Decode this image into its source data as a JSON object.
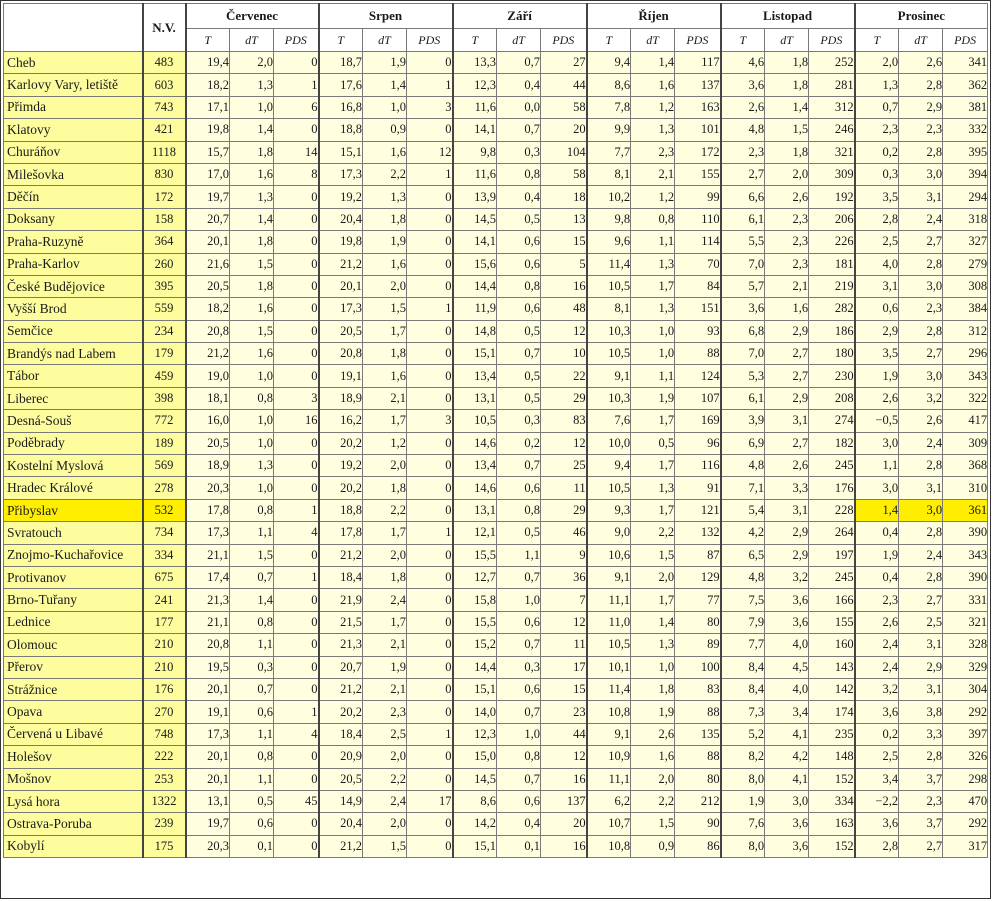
{
  "header": {
    "nv": "N.V.",
    "months": [
      "Červenec",
      "Srpen",
      "Září",
      "Říjen",
      "Listopad",
      "Prosinec"
    ],
    "sub": [
      "T",
      "dT",
      "PDS"
    ]
  },
  "rows": [
    {
      "name": "Cheb",
      "nv": "483",
      "v": [
        "19,4",
        "2,0",
        "0",
        "18,7",
        "1,9",
        "0",
        "13,3",
        "0,7",
        "27",
        "9,4",
        "1,4",
        "117",
        "4,6",
        "1,8",
        "252",
        "2,0",
        "2,6",
        "341"
      ]
    },
    {
      "name": "Karlovy Vary, letiště",
      "nv": "603",
      "v": [
        "18,2",
        "1,3",
        "1",
        "17,6",
        "1,4",
        "1",
        "12,3",
        "0,4",
        "44",
        "8,6",
        "1,6",
        "137",
        "3,6",
        "1,8",
        "281",
        "1,3",
        "2,8",
        "362"
      ]
    },
    {
      "name": "Přimda",
      "nv": "743",
      "v": [
        "17,1",
        "1,0",
        "6",
        "16,8",
        "1,0",
        "3",
        "11,6",
        "0,0",
        "58",
        "7,8",
        "1,2",
        "163",
        "2,6",
        "1,4",
        "312",
        "0,7",
        "2,9",
        "381"
      ]
    },
    {
      "name": "Klatovy",
      "nv": "421",
      "v": [
        "19,8",
        "1,4",
        "0",
        "18,8",
        "0,9",
        "0",
        "14,1",
        "0,7",
        "20",
        "9,9",
        "1,3",
        "101",
        "4,8",
        "1,5",
        "246",
        "2,3",
        "2,3",
        "332"
      ]
    },
    {
      "name": "Churáňov",
      "nv": "1118",
      "v": [
        "15,7",
        "1,8",
        "14",
        "15,1",
        "1,6",
        "12",
        "9,8",
        "0,3",
        "104",
        "7,7",
        "2,3",
        "172",
        "2,3",
        "1,8",
        "321",
        "0,2",
        "2,8",
        "395"
      ]
    },
    {
      "name": "Milešovka",
      "nv": "830",
      "v": [
        "17,0",
        "1,6",
        "8",
        "17,3",
        "2,2",
        "1",
        "11,6",
        "0,8",
        "58",
        "8,1",
        "2,1",
        "155",
        "2,7",
        "2,0",
        "309",
        "0,3",
        "3,0",
        "394"
      ]
    },
    {
      "name": "Děčín",
      "nv": "172",
      "v": [
        "19,7",
        "1,3",
        "0",
        "19,2",
        "1,3",
        "0",
        "13,9",
        "0,4",
        "18",
        "10,2",
        "1,2",
        "99",
        "6,6",
        "2,6",
        "192",
        "3,5",
        "3,1",
        "294"
      ]
    },
    {
      "name": "Doksany",
      "nv": "158",
      "v": [
        "20,7",
        "1,4",
        "0",
        "20,4",
        "1,8",
        "0",
        "14,5",
        "0,5",
        "13",
        "9,8",
        "0,8",
        "110",
        "6,1",
        "2,3",
        "206",
        "2,8",
        "2,4",
        "318"
      ]
    },
    {
      "name": "Praha-Ruzyně",
      "nv": "364",
      "v": [
        "20,1",
        "1,8",
        "0",
        "19,8",
        "1,9",
        "0",
        "14,1",
        "0,6",
        "15",
        "9,6",
        "1,1",
        "114",
        "5,5",
        "2,3",
        "226",
        "2,5",
        "2,7",
        "327"
      ]
    },
    {
      "name": "Praha-Karlov",
      "nv": "260",
      "v": [
        "21,6",
        "1,5",
        "0",
        "21,2",
        "1,6",
        "0",
        "15,6",
        "0,6",
        "5",
        "11,4",
        "1,3",
        "70",
        "7,0",
        "2,3",
        "181",
        "4,0",
        "2,8",
        "279"
      ]
    },
    {
      "name": "České Budějovice",
      "nv": "395",
      "v": [
        "20,5",
        "1,8",
        "0",
        "20,1",
        "2,0",
        "0",
        "14,4",
        "0,8",
        "16",
        "10,5",
        "1,7",
        "84",
        "5,7",
        "2,1",
        "219",
        "3,1",
        "3,0",
        "308"
      ]
    },
    {
      "name": "Vyšší Brod",
      "nv": "559",
      "v": [
        "18,2",
        "1,6",
        "0",
        "17,3",
        "1,5",
        "1",
        "11,9",
        "0,6",
        "48",
        "8,1",
        "1,3",
        "151",
        "3,6",
        "1,6",
        "282",
        "0,6",
        "2,3",
        "384"
      ]
    },
    {
      "name": "Semčice",
      "nv": "234",
      "v": [
        "20,8",
        "1,5",
        "0",
        "20,5",
        "1,7",
        "0",
        "14,8",
        "0,5",
        "12",
        "10,3",
        "1,0",
        "93",
        "6,8",
        "2,9",
        "186",
        "2,9",
        "2,8",
        "312"
      ]
    },
    {
      "name": "Brandýs nad Labem",
      "nv": "179",
      "v": [
        "21,2",
        "1,6",
        "0",
        "20,8",
        "1,8",
        "0",
        "15,1",
        "0,7",
        "10",
        "10,5",
        "1,0",
        "88",
        "7,0",
        "2,7",
        "180",
        "3,5",
        "2,7",
        "296"
      ]
    },
    {
      "name": "Tábor",
      "nv": "459",
      "v": [
        "19,0",
        "1,0",
        "0",
        "19,1",
        "1,6",
        "0",
        "13,4",
        "0,5",
        "22",
        "9,1",
        "1,1",
        "124",
        "5,3",
        "2,7",
        "230",
        "1,9",
        "3,0",
        "343"
      ]
    },
    {
      "name": "Liberec",
      "nv": "398",
      "v": [
        "18,1",
        "0,8",
        "3",
        "18,9",
        "2,1",
        "0",
        "13,1",
        "0,5",
        "29",
        "10,3",
        "1,9",
        "107",
        "6,1",
        "2,9",
        "208",
        "2,6",
        "3,2",
        "322"
      ]
    },
    {
      "name": "Desná-Souš",
      "nv": "772",
      "v": [
        "16,0",
        "1,0",
        "16",
        "16,2",
        "1,7",
        "3",
        "10,5",
        "0,3",
        "83",
        "7,6",
        "1,7",
        "169",
        "3,9",
        "3,1",
        "274",
        "−0,5",
        "2,6",
        "417"
      ]
    },
    {
      "name": "Poděbrady",
      "nv": "189",
      "v": [
        "20,5",
        "1,0",
        "0",
        "20,2",
        "1,2",
        "0",
        "14,6",
        "0,2",
        "12",
        "10,0",
        "0,5",
        "96",
        "6,9",
        "2,7",
        "182",
        "3,0",
        "2,4",
        "309"
      ]
    },
    {
      "name": "Kostelní Myslová",
      "nv": "569",
      "v": [
        "18,9",
        "1,3",
        "0",
        "19,2",
        "2,0",
        "0",
        "13,4",
        "0,7",
        "25",
        "9,4",
        "1,7",
        "116",
        "4,8",
        "2,6",
        "245",
        "1,1",
        "2,8",
        "368"
      ]
    },
    {
      "name": "Hradec Králové",
      "nv": "278",
      "v": [
        "20,3",
        "1,0",
        "0",
        "20,2",
        "1,8",
        "0",
        "14,6",
        "0,6",
        "11",
        "10,5",
        "1,3",
        "91",
        "7,1",
        "3,3",
        "176",
        "3,0",
        "3,1",
        "310"
      ]
    },
    {
      "name": "Přibyslav",
      "nv": "532",
      "v": [
        "17,8",
        "0,8",
        "1",
        "18,8",
        "2,2",
        "0",
        "13,1",
        "0,8",
        "29",
        "9,3",
        "1,7",
        "121",
        "5,4",
        "3,1",
        "228",
        "1,4",
        "3,0",
        "361"
      ],
      "highlight": true
    },
    {
      "name": "Svratouch",
      "nv": "734",
      "v": [
        "17,3",
        "1,1",
        "4",
        "17,8",
        "1,7",
        "1",
        "12,1",
        "0,5",
        "46",
        "9,0",
        "2,2",
        "132",
        "4,2",
        "2,9",
        "264",
        "0,4",
        "2,8",
        "390"
      ]
    },
    {
      "name": "Znojmo-Kuchařovice",
      "nv": "334",
      "v": [
        "21,1",
        "1,5",
        "0",
        "21,2",
        "2,0",
        "0",
        "15,5",
        "1,1",
        "9",
        "10,6",
        "1,5",
        "87",
        "6,5",
        "2,9",
        "197",
        "1,9",
        "2,4",
        "343"
      ]
    },
    {
      "name": "Protivanov",
      "nv": "675",
      "v": [
        "17,4",
        "0,7",
        "1",
        "18,4",
        "1,8",
        "0",
        "12,7",
        "0,7",
        "36",
        "9,1",
        "2,0",
        "129",
        "4,8",
        "3,2",
        "245",
        "0,4",
        "2,8",
        "390"
      ]
    },
    {
      "name": "Brno-Tuřany",
      "nv": "241",
      "v": [
        "21,3",
        "1,4",
        "0",
        "21,9",
        "2,4",
        "0",
        "15,8",
        "1,0",
        "7",
        "11,1",
        "1,7",
        "77",
        "7,5",
        "3,6",
        "166",
        "2,3",
        "2,7",
        "331"
      ]
    },
    {
      "name": "Lednice",
      "nv": "177",
      "v": [
        "21,1",
        "0,8",
        "0",
        "21,5",
        "1,7",
        "0",
        "15,5",
        "0,6",
        "12",
        "11,0",
        "1,4",
        "80",
        "7,9",
        "3,6",
        "155",
        "2,6",
        "2,5",
        "321"
      ]
    },
    {
      "name": "Olomouc",
      "nv": "210",
      "v": [
        "20,8",
        "1,1",
        "0",
        "21,3",
        "2,1",
        "0",
        "15,2",
        "0,7",
        "11",
        "10,5",
        "1,3",
        "89",
        "7,7",
        "4,0",
        "160",
        "2,4",
        "3,1",
        "328"
      ]
    },
    {
      "name": "Přerov",
      "nv": "210",
      "v": [
        "19,5",
        "0,3",
        "0",
        "20,7",
        "1,9",
        "0",
        "14,4",
        "0,3",
        "17",
        "10,1",
        "1,0",
        "100",
        "8,4",
        "4,5",
        "143",
        "2,4",
        "2,9",
        "329"
      ]
    },
    {
      "name": "Strážnice",
      "nv": "176",
      "v": [
        "20,1",
        "0,7",
        "0",
        "21,2",
        "2,1",
        "0",
        "15,1",
        "0,6",
        "15",
        "11,4",
        "1,8",
        "83",
        "8,4",
        "4,0",
        "142",
        "3,2",
        "3,1",
        "304"
      ]
    },
    {
      "name": "Opava",
      "nv": "270",
      "v": [
        "19,1",
        "0,6",
        "1",
        "20,2",
        "2,3",
        "0",
        "14,0",
        "0,7",
        "23",
        "10,8",
        "1,9",
        "88",
        "7,3",
        "3,4",
        "174",
        "3,6",
        "3,8",
        "292"
      ]
    },
    {
      "name": "Červená u Libavé",
      "nv": "748",
      "v": [
        "17,3",
        "1,1",
        "4",
        "18,4",
        "2,5",
        "1",
        "12,3",
        "1,0",
        "44",
        "9,1",
        "2,6",
        "135",
        "5,2",
        "4,1",
        "235",
        "0,2",
        "3,3",
        "397"
      ]
    },
    {
      "name": "Holešov",
      "nv": "222",
      "v": [
        "20,1",
        "0,8",
        "0",
        "20,9",
        "2,0",
        "0",
        "15,0",
        "0,8",
        "12",
        "10,9",
        "1,6",
        "88",
        "8,2",
        "4,2",
        "148",
        "2,5",
        "2,8",
        "326"
      ]
    },
    {
      "name": "Mošnov",
      "nv": "253",
      "v": [
        "20,1",
        "1,1",
        "0",
        "20,5",
        "2,2",
        "0",
        "14,5",
        "0,7",
        "16",
        "11,1",
        "2,0",
        "80",
        "8,0",
        "4,1",
        "152",
        "3,4",
        "3,7",
        "298"
      ]
    },
    {
      "name": "Lysá hora",
      "nv": "1322",
      "v": [
        "13,1",
        "0,5",
        "45",
        "14,9",
        "2,4",
        "17",
        "8,6",
        "0,6",
        "137",
        "6,2",
        "2,2",
        "212",
        "1,9",
        "3,0",
        "334",
        "−2,2",
        "2,3",
        "470"
      ]
    },
    {
      "name": "Ostrava-Poruba",
      "nv": "239",
      "v": [
        "19,7",
        "0,6",
        "0",
        "20,4",
        "2,0",
        "0",
        "14,2",
        "0,4",
        "20",
        "10,7",
        "1,5",
        "90",
        "7,6",
        "3,6",
        "163",
        "3,6",
        "3,7",
        "292"
      ]
    },
    {
      "name": "Kobylí",
      "nv": "175",
      "v": [
        "20,3",
        "0,1",
        "0",
        "21,2",
        "1,5",
        "0",
        "15,1",
        "0,1",
        "16",
        "10,8",
        "0,9",
        "86",
        "8,0",
        "3,6",
        "152",
        "2,8",
        "2,7",
        "317"
      ]
    }
  ]
}
